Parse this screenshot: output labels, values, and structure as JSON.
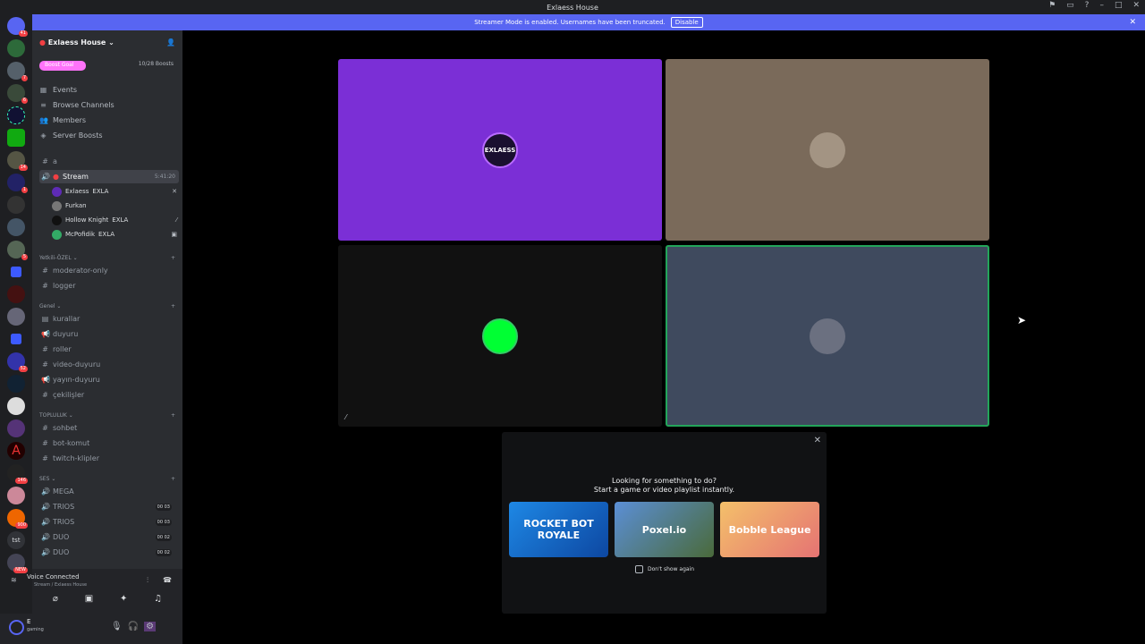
{
  "window": {
    "title": "Exlaess House"
  },
  "banner": {
    "text": "Streamer Mode is enabled. Usernames have been truncated.",
    "button": "Disable"
  },
  "server_rail": {
    "badges": [
      "41",
      "7",
      "6",
      "14",
      "1",
      "5",
      "52",
      "146",
      "900",
      "NEW"
    ],
    "tst_label": "tst"
  },
  "server": {
    "name": "Exlaess House",
    "boost_goal_label": "Boost Goal",
    "boost_count": "10/28 Boosts",
    "menu": [
      "Events",
      "Browse Channels",
      "Members",
      "Server Boosts"
    ]
  },
  "channels": {
    "top_text": "a",
    "stream": {
      "name": "Stream",
      "time": "5:41:20"
    },
    "voice_users": [
      {
        "name": "Exlaess",
        "tag": "EXLA"
      },
      {
        "name": "Furkan",
        "tag": ""
      },
      {
        "name": "Hollow Knight",
        "tag": "EXLA"
      },
      {
        "name": "McPofidik",
        "tag": "EXLA"
      }
    ],
    "cat_yetkili": "Yetkili-ÖZEL",
    "yetkili": [
      "moderator-only",
      "logger"
    ],
    "cat_genel": "Genel",
    "genel": [
      "kurallar",
      "duyuru",
      "roller",
      "video-duyuru",
      "yayın-duyuru",
      "çekilişler"
    ],
    "cat_topluluk": "TOPLULUK",
    "topluluk": [
      "sohbet",
      "bot-komut",
      "twitch-klipler"
    ],
    "cat_ses": "SES",
    "ses": [
      {
        "name": "MEGA",
        "count": ""
      },
      {
        "name": "TRIOS",
        "count": "00 03"
      },
      {
        "name": "TRIOS",
        "count": "00 03"
      },
      {
        "name": "DUO",
        "count": "00 02"
      },
      {
        "name": "DUO",
        "count": "00 02"
      }
    ]
  },
  "voice_panel": {
    "title": "Voice Connected",
    "subtitle": "Stream / Exlaess House"
  },
  "user": {
    "name": "E",
    "status": "gaming"
  },
  "stage": {
    "tile1_label": "EXLAESS",
    "promo": {
      "line1": "Looking for something to do?",
      "line2": "Start a game or video playlist instantly.",
      "cards": [
        "ROCKET BOT ROYALE",
        "Poxel.io",
        "Bobble League"
      ],
      "dont_show": "Don't show again"
    }
  },
  "colors": {
    "accent": "#5865f2",
    "tile_purple": "#7b2fd6",
    "tile_brown": "#7a6a5a",
    "tile_blue": "#3f4a5e"
  }
}
